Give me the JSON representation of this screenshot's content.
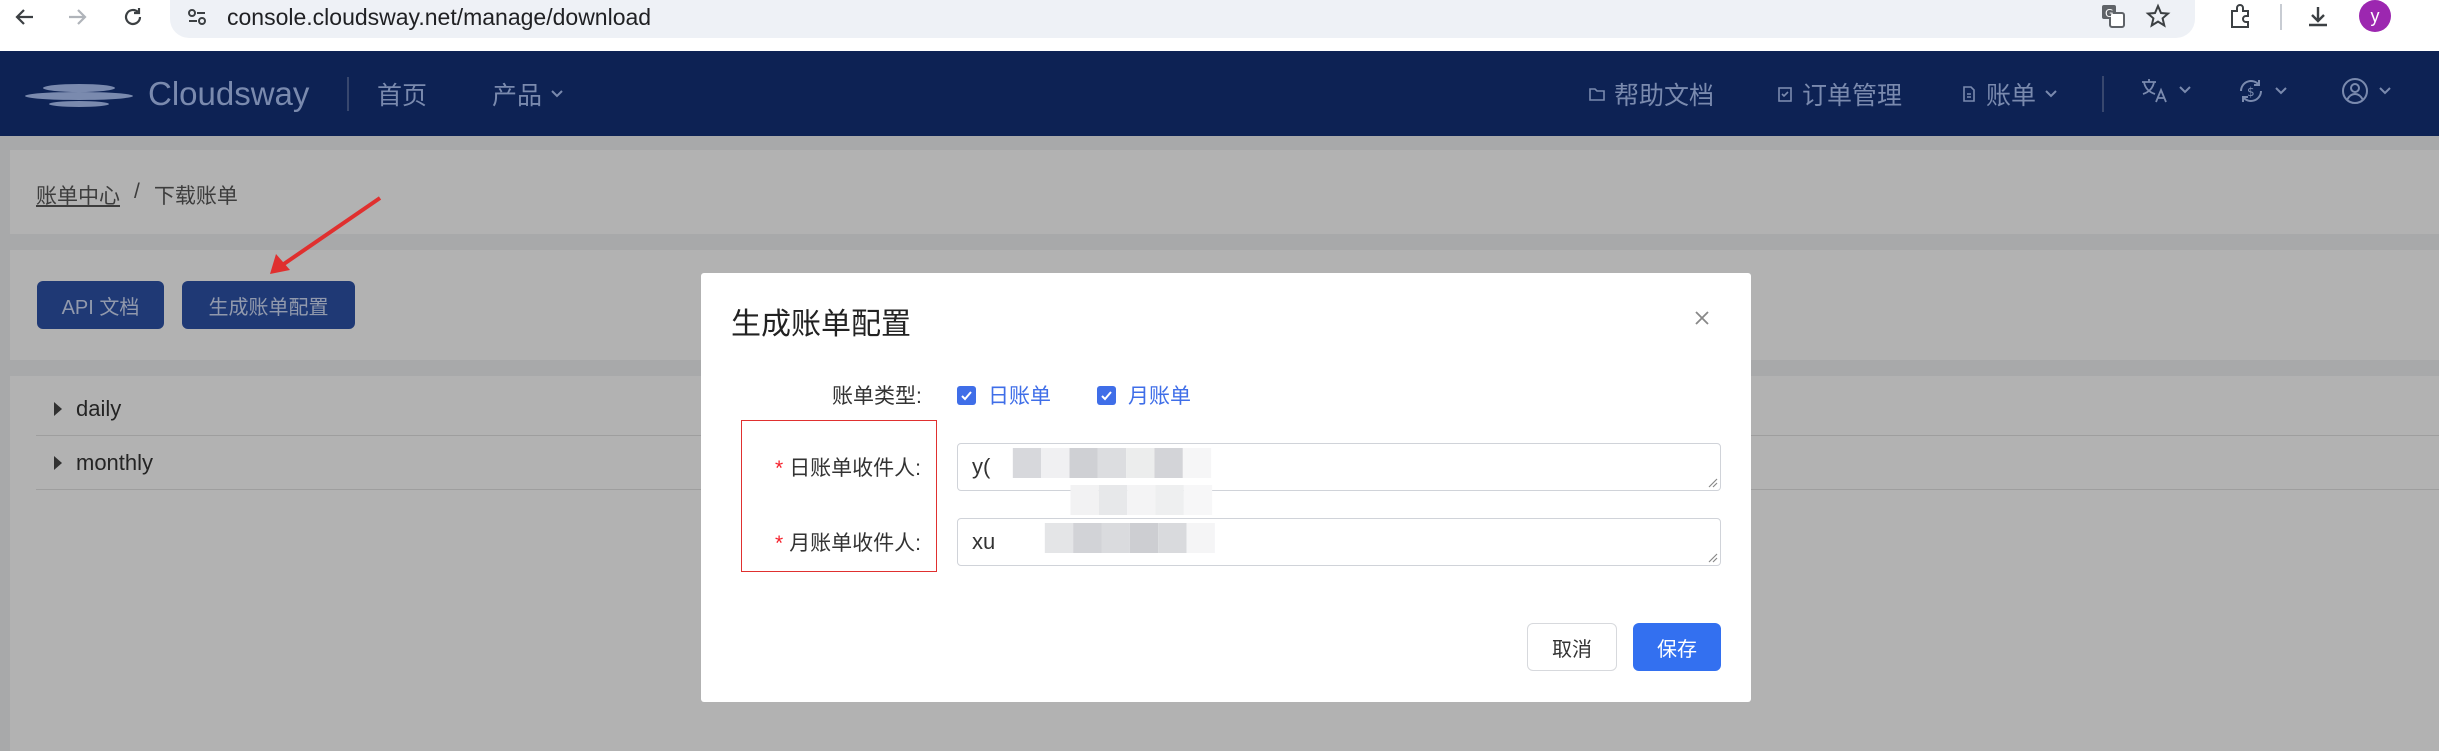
{
  "browser": {
    "url": "console.cloudsway.net/manage/download",
    "profile_initial": "y"
  },
  "header": {
    "logo_text": "Cloudsway",
    "nav_home": "首页",
    "nav_products": "产品",
    "help_docs": "帮助文档",
    "orders": "订单管理",
    "billing": "账单"
  },
  "breadcrumb": {
    "parent": "账单中心",
    "separator": "/",
    "current": "下载账单"
  },
  "toolbar": {
    "api_docs": "API 文档",
    "generate_config": "生成账单配置"
  },
  "list": {
    "items": [
      "daily",
      "monthly"
    ]
  },
  "modal": {
    "title": "生成账单配置",
    "bill_type_label": "账单类型:",
    "daily_option": "日账单",
    "monthly_option": "月账单",
    "daily_recipient_label": "日账单收件人:",
    "monthly_recipient_label": "月账单收件人:",
    "required_mark": "*",
    "daily_recipient_value": "y(",
    "monthly_recipient_value": "xu",
    "cancel": "取消",
    "save": "保存"
  },
  "colors": {
    "header_bg": "#0d2254",
    "primary": "#3370f0",
    "checkbox": "#3f6ee8",
    "required": "#f5222d",
    "annotation": "#e0302f"
  }
}
